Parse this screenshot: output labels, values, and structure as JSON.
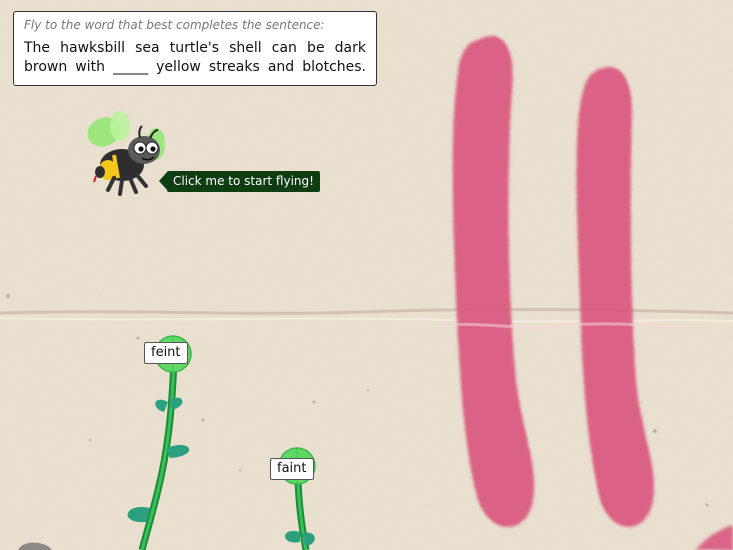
{
  "prompt": {
    "instruction": "Fly to the word that best completes the sentence:",
    "sentence": "The hawksbill sea turtle's shell can be dark brown with _____ yellow streaks and blotches."
  },
  "bee": {
    "tooltip": "Click me to start flying!"
  },
  "answers": [
    {
      "word": "feint"
    },
    {
      "word": "faint"
    }
  ],
  "colors": {
    "tooltip_bg": "#0f3d12",
    "graffiti": "#d9577f",
    "stem": "#2aa84a",
    "flower_head": "#5fd866"
  }
}
